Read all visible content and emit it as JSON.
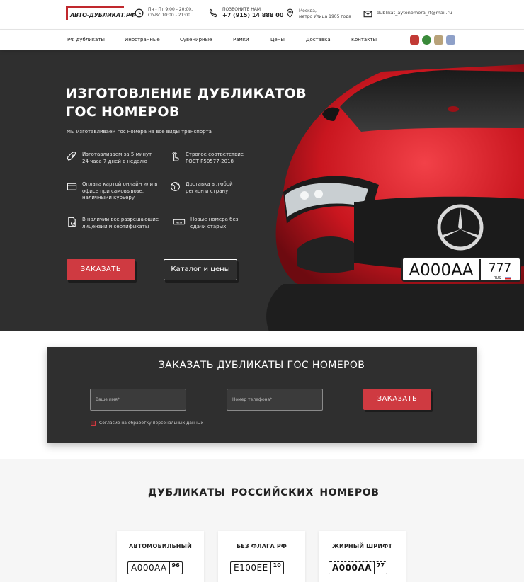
{
  "header": {
    "logo_text": "АВТО-ДУБЛИКАТ.РФ",
    "hours_line1": "Пн - Пт 9:00 - 20:00,",
    "hours_line2": "Сб-Вс 10:00 - 21:00",
    "call_label": "ПОЗВОНИТЕ НАМ",
    "phone": "+7 (915) 14 888 00",
    "address_line1": "Москва,",
    "address_line2": "метро Улица 1905 года",
    "email": "dublikat_aytonomera_rf@mail.ru"
  },
  "nav": {
    "items": [
      "РФ дубликаты",
      "Иностранные",
      "Сувенирные",
      "Рамки",
      "Цены",
      "Доставка",
      "Контакты"
    ]
  },
  "hero": {
    "title": "ИЗГОТОВЛЕНИЕ ДУБЛИКАТОВ ГОС НОМЕРОВ",
    "subtitle": "Мы изготавливаем гос номера на все виды транспорта",
    "features": [
      {
        "icon": "rocket-icon",
        "text": "Изготавливаем за 5 минут 24 часа 7 дней в неделю"
      },
      {
        "icon": "hand-pointer-icon",
        "text": "Строгое соответствие ГОСТ Р50577-2018"
      },
      {
        "icon": "wallet-icon",
        "text": "Оплата картой онлайн или в офисе при самовывозе, наличными курьеру"
      },
      {
        "icon": "globe-icon",
        "text": "Доставка в любой регион и страну"
      },
      {
        "icon": "certificate-icon",
        "text": "В наличии все разрешающие лицензии и сертификаты"
      },
      {
        "icon": "new-badge-icon",
        "text": "Новые номера без сдачи старых"
      }
    ],
    "order_button": "ЗАКАЗАТЬ",
    "catalog_button": "Каталог и цены",
    "plate_number": "А000АА",
    "plate_region": "777",
    "plate_country": "RUS"
  },
  "order_form": {
    "title": "ЗАКАЗАТЬ ДУБЛИКАТЫ ГОС НОМЕРОВ",
    "name_placeholder": "Ваше имя*",
    "phone_placeholder": "Номер телефона*",
    "submit": "ЗАКАЗАТЬ",
    "consent": "Согласие на обработку персональных данных"
  },
  "catalog": {
    "title": "ДУБЛИКАТЫ РОССИЙСКИХ НОМЕРОВ",
    "cards": [
      {
        "title": "АВТОМОБИЛЬНЫЙ",
        "plate": "А000АА",
        "region": "96"
      },
      {
        "title": "БЕЗ ФЛАГА РФ",
        "plate": "Е100ЕЕ",
        "region": "10"
      },
      {
        "title": "ЖИРНЫЙ ШРИФТ",
        "plate": "А000АА",
        "region": "77"
      }
    ]
  },
  "colors": {
    "accent": "#cf3a41",
    "dark_bg": "#2f2f2f"
  }
}
